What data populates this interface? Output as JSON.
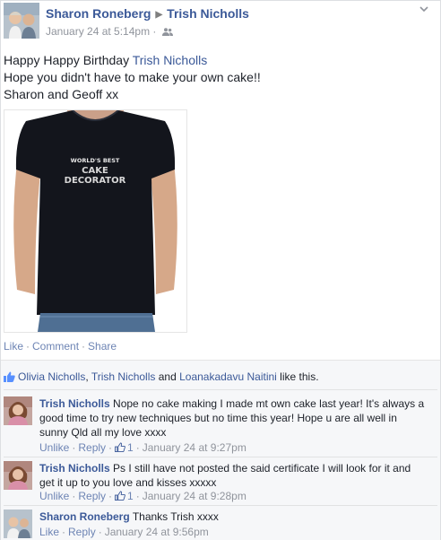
{
  "post": {
    "author": "Sharon Roneberg",
    "target": "Trish Nicholls",
    "timestamp": "January 24 at 5:14pm",
    "audience_icon": "friends-icon",
    "message": {
      "prefix": "Happy Happy Birthday ",
      "tagged": "Trish Nicholls",
      "line2": "Hope you didn't have to make your own cake!!",
      "line3": "Sharon and Geoff xx"
    },
    "photo": {
      "shirt_text_1": "WORLD'S BEST",
      "shirt_text_2": "CAKE",
      "shirt_text_3": "DECORATOR"
    },
    "actions": {
      "like": "Like",
      "comment": "Comment",
      "share": "Share"
    }
  },
  "feedback": {
    "likes": {
      "name1": "Olivia Nicholls",
      "name2": "Trish Nicholls",
      "and": " and ",
      "name3": "Loanakadavu Naitini",
      "suffix": " like this.",
      "comma": ", "
    },
    "comments": [
      {
        "author": "Trish Nicholls",
        "text": "Nope no cake making I made mt own cake last year! It's always a good time to try new techniques but no time this year! Hope u are all well in sunny Qld all my love xxxx",
        "unlike": "Unlike",
        "reply": "Reply",
        "like_count": "1",
        "time": "January 24 at 9:27pm"
      },
      {
        "author": "Trish Nicholls",
        "text": "Ps I still have not posted the said certificate I will look for it and get it up to you love and kisses xxxxx",
        "unlike": "Unlike",
        "reply": "Reply",
        "like_count": "1",
        "time": "January 24 at 9:28pm"
      },
      {
        "author": "Sharon Roneberg",
        "text": "Thanks Trish xxxx",
        "like": "Like",
        "reply": "Reply",
        "time": "January 24 at 9:56pm"
      }
    ]
  },
  "colors": {
    "link": "#3b5998",
    "meta": "#90949c",
    "feedback_bg": "#f6f7f9"
  }
}
